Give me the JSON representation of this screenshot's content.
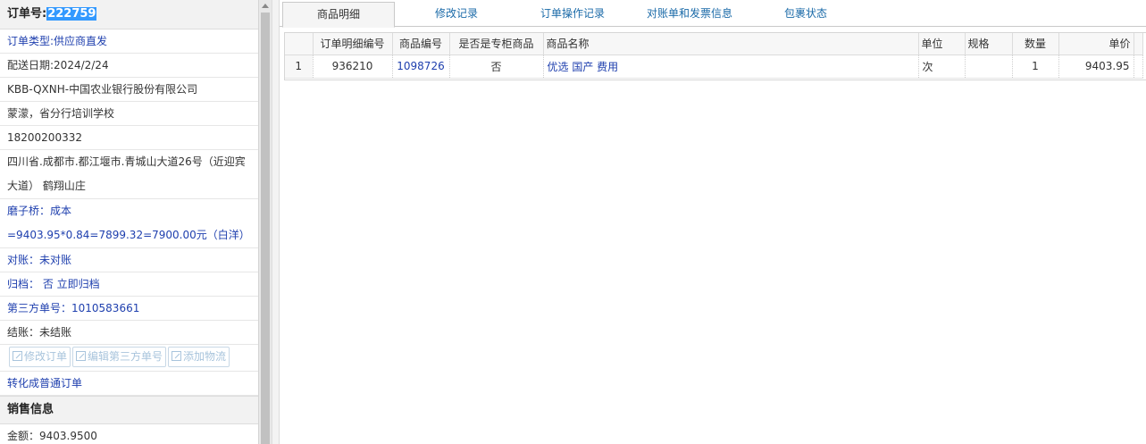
{
  "left": {
    "order_no_label": "订单号:",
    "order_no": "222759",
    "order_type": "订单类型:供应商直发",
    "delivery_date": "配送日期:2024/2/24",
    "company": "KBB-QXNH-中国农业银行股份有限公司",
    "contact": "蒙濛，省分行培训学校",
    "phone": "18200200332",
    "address": "四川省.成都市.都江堰市.青城山大道26号（近迎宾大道） 鹤翔山庄",
    "note": "磨子桥：成本=9403.95*0.84=7899.32=7900.00元（白洋）",
    "reconcile": "对账：未对账",
    "archive": "归档： 否 立即归档",
    "third_party": "第三方单号：1010583661",
    "settle": "结账：未结账",
    "buttons": [
      "修改订单",
      "编辑第三方单号",
      "添加物流"
    ],
    "convert_link": "转化成普通订单",
    "sales_section": "销售信息",
    "amount": "金额：9403.9500"
  },
  "tabs": [
    {
      "label": "商品明细",
      "active": true
    },
    {
      "label": "修改记录",
      "active": false
    },
    {
      "label": "订单操作记录",
      "active": false
    },
    {
      "label": "对账单和发票信息",
      "active": false
    },
    {
      "label": "包裹状态",
      "active": false
    }
  ],
  "table": {
    "headers": [
      "",
      "订单明细编号",
      "商品编号",
      "是否是专柜商品",
      "商品名称",
      "单位",
      "规格",
      "数量",
      "单价"
    ],
    "rows": [
      [
        "1",
        "936210",
        "1098726",
        "否",
        "优选 国产 费用",
        "次",
        "",
        "1",
        "9403.95"
      ]
    ]
  }
}
